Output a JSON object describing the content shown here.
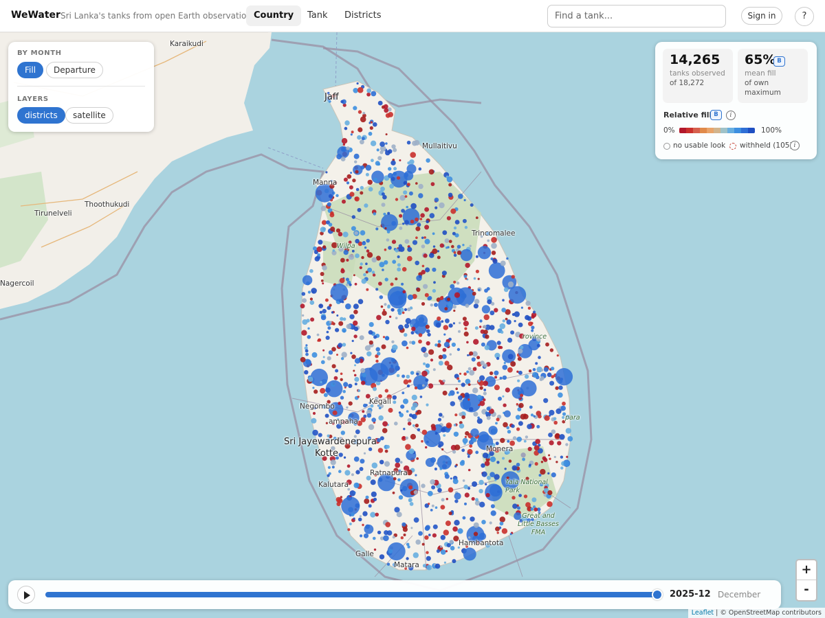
{
  "header": {
    "brand": "WeWater",
    "tagline": "Sri Lanka's tanks from open Earth observation",
    "tabs": [
      {
        "label": "Country",
        "active": true
      },
      {
        "label": "Tank",
        "active": false
      },
      {
        "label": "Districts",
        "active": false
      }
    ],
    "search_placeholder": "Find a tank...",
    "signin_label": "Sign in",
    "help_label": "?"
  },
  "left_panel": {
    "by_month_title": "BY MONTH",
    "by_month_options": [
      {
        "label": "Fill",
        "active": true
      },
      {
        "label": "Departure",
        "active": false
      }
    ],
    "layers_title": "LAYERS",
    "layer_options": [
      {
        "label": "districts",
        "active": true
      },
      {
        "label": "satellite",
        "active": false
      }
    ]
  },
  "stats": {
    "observed_value": "14,265",
    "observed_label": "tanks observed",
    "observed_total": "of 18,272",
    "mean_fill_value": "65%",
    "mean_fill_badge": "B",
    "mean_fill_label": "mean fill",
    "mean_fill_sub1": "of own",
    "mean_fill_sub2": "maximum"
  },
  "legend": {
    "title": "Relative fill",
    "badge": "B",
    "info": "i",
    "min_label": "0%",
    "max_label": "100%",
    "ramp_colors": [
      "#b2182b",
      "#c9302c",
      "#d6604d",
      "#e08a4a",
      "#e9a46a",
      "#d2b48c",
      "#9fc2c8",
      "#67aee0",
      "#3d8fe0",
      "#2e6fd6",
      "#1f4fc2"
    ],
    "no_usable_label": "no usable look",
    "withheld_label": "withheld (105)",
    "withheld_info": "i",
    "accent_color": "#2f74d0"
  },
  "timeline": {
    "period": "2025-12",
    "month_name": "December",
    "progress": 1.0
  },
  "zoom": {
    "in": "+",
    "out": "-"
  },
  "attribution": {
    "leaflet": "Leaflet",
    "rest": " | © OpenStreetMap contributors"
  },
  "map_labels": {
    "karaikudi": "Karaikudi",
    "jaffna": "Jaff",
    "mullaitivu": "Mullaitivu",
    "mannar": "Manna",
    "thoothukudi": "Thoothukudi",
    "tirunelveli": "Tirunelveli",
    "nagercoil": "Nagercoil",
    "trincomalee": "Trincomalee",
    "wilpattu": "Wilpa",
    "negombo": "Negombo",
    "gampaha": "ampaha",
    "kegalle": "Kegall",
    "colombo": "Sri Jayewardenepura",
    "kotte": "Kotte",
    "kalutara": "Kalutara",
    "ratnapura": "Ratnapura",
    "monaragala": "Monera",
    "yala": "Yala National Park",
    "great_basses": "Great and Little Basses FMA",
    "hambantota": "Hambantota",
    "galle": "Galle",
    "matara": "Matara",
    "province": "rovince",
    "ampara": "para"
  }
}
